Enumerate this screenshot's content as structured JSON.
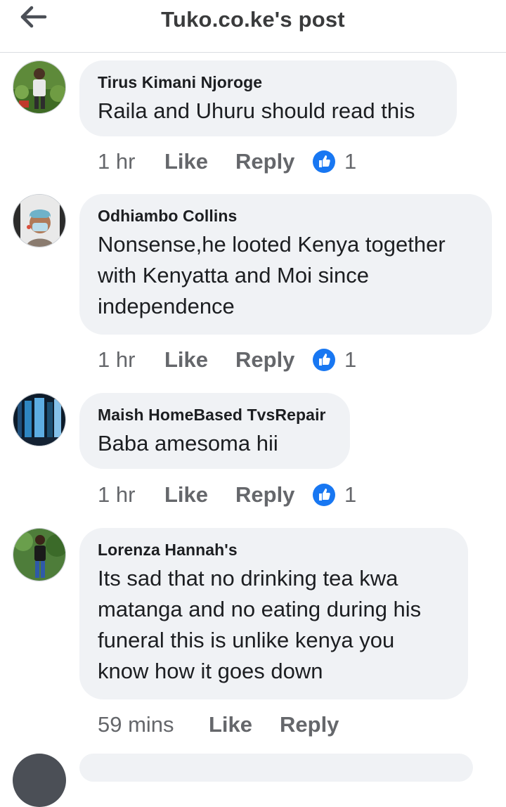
{
  "header": {
    "title": "Tuko.co.ke's post",
    "back_icon": "back-arrow-icon"
  },
  "colors": {
    "bubble": "#f0f2f5",
    "text": "#1c1e21",
    "secondary": "#65676b",
    "like_blue": "#1877f2"
  },
  "comments": [
    {
      "author": "Tirus Kimani Njoroge",
      "text": "Raila and Uhuru should read this",
      "time": "1 hr",
      "like_label": "Like",
      "reply_label": "Reply",
      "reaction_count": "1"
    },
    {
      "author": "Odhiambo Collins",
      "text": "Nonsense,he looted Kenya together with Kenyatta and Moi since independence",
      "time": "1 hr",
      "like_label": "Like",
      "reply_label": "Reply",
      "reaction_count": "1"
    },
    {
      "author": "Maish HomeBased TvsRepair",
      "text": "Baba amesoma hii",
      "time": "1 hr",
      "like_label": "Like",
      "reply_label": "Reply",
      "reaction_count": "1"
    },
    {
      "author": "Lorenza Hannah's",
      "text": "Its sad that no drinking tea kwa matanga and no eating during his funeral this is unlike kenya you know how it goes down",
      "time": "59 mins",
      "like_label": "Like",
      "reply_label": "Reply"
    }
  ]
}
